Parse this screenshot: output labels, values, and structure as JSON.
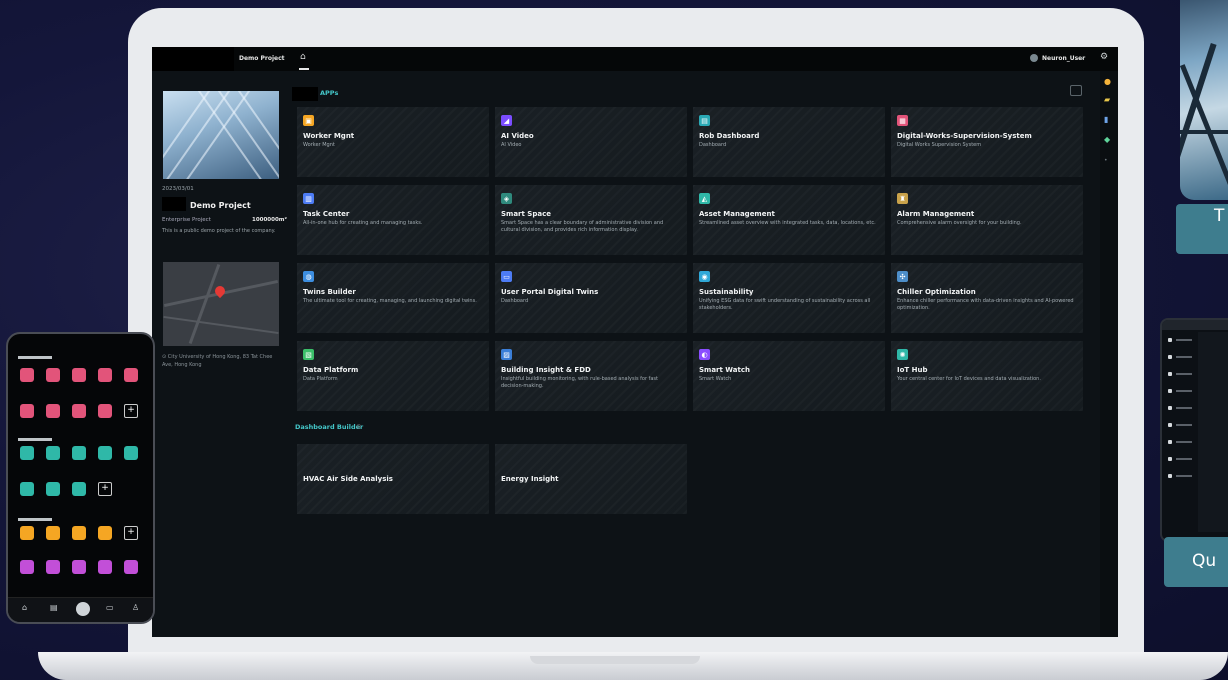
{
  "topbar": {
    "project": "Demo Project",
    "user": "Neuron_User"
  },
  "project_panel": {
    "date": "2023/03/01",
    "name": "Demo Project",
    "type": "Enterprise Project",
    "area": "1000000m²",
    "description": "This is a public demo project of the company.",
    "address": "City University of Hong Kong, 83 Tat Chee Ave, Hong Kong"
  },
  "apps": {
    "title": "APPs",
    "cards": [
      {
        "title": "Worker Mgnt",
        "desc": "Worker Mgnt",
        "color": "#f5a623",
        "glyph": "▣"
      },
      {
        "title": "AI Video",
        "desc": "AI Video",
        "color": "#7b4dff",
        "glyph": "◢"
      },
      {
        "title": "Rob Dashboard",
        "desc": "Dashboard",
        "color": "#2aa9b5",
        "glyph": "▤"
      },
      {
        "title": "Digital-Works-Supervision-System",
        "desc": "Digital Works Supervision System",
        "color": "#e2547a",
        "glyph": "▦"
      },
      {
        "title": "Task Center",
        "desc": "All-in-one hub for creating and managing tasks.",
        "color": "#4d7cf5",
        "glyph": "▥"
      },
      {
        "title": "Smart Space",
        "desc": "Smart Space has a clear boundary of administrative division and cultural division, and provides rich information display.",
        "color": "#2f8a7d",
        "glyph": "◈"
      },
      {
        "title": "Asset Management",
        "desc": "Streamlined asset overview with integrated tasks, data, locations, etc.",
        "color": "#2fb8a8",
        "glyph": "◭"
      },
      {
        "title": "Alarm Management",
        "desc": "Comprehensive alarm oversight for your building.",
        "color": "#c9a24a",
        "glyph": "♜"
      },
      {
        "title": "Twins Builder",
        "desc": "The ultimate tool for creating, managing, and launching digital twins.",
        "color": "#3d8ee0",
        "glyph": "◍"
      },
      {
        "title": "User Portal Digital Twins",
        "desc": "Dashboard",
        "color": "#4d7cf5",
        "glyph": "▭"
      },
      {
        "title": "Sustainability",
        "desc": "Unifying ESG data for swift understanding of sustainability across all stakeholders.",
        "color": "#2fa8d8",
        "glyph": "◉"
      },
      {
        "title": "Chiller Optimization",
        "desc": "Enhance chiller performance with data-driven insights and AI-powered optimization.",
        "color": "#4d8ec9",
        "glyph": "✣"
      },
      {
        "title": "Data Platform",
        "desc": "Data Platform",
        "color": "#3bbf6a",
        "glyph": "▧"
      },
      {
        "title": "Building Insight & FDD",
        "desc": "Insightful building monitoring, with rule-based analysis for fast decision-making.",
        "color": "#3b7fd8",
        "glyph": "▨"
      },
      {
        "title": "Smart Watch",
        "desc": "Smart Watch",
        "color": "#8a4dff",
        "glyph": "◐"
      },
      {
        "title": "IoT Hub",
        "desc": "Your central center for IoT devices and data visualization.",
        "color": "#2fb8a8",
        "glyph": "✺"
      }
    ]
  },
  "dashboard_builder": {
    "title": "Dashboard Builder",
    "cards": [
      "HVAC Air Side Analysis",
      "Energy Insight"
    ]
  },
  "side_snippets": {
    "top_button": "T",
    "bottom_button": "Qu"
  }
}
